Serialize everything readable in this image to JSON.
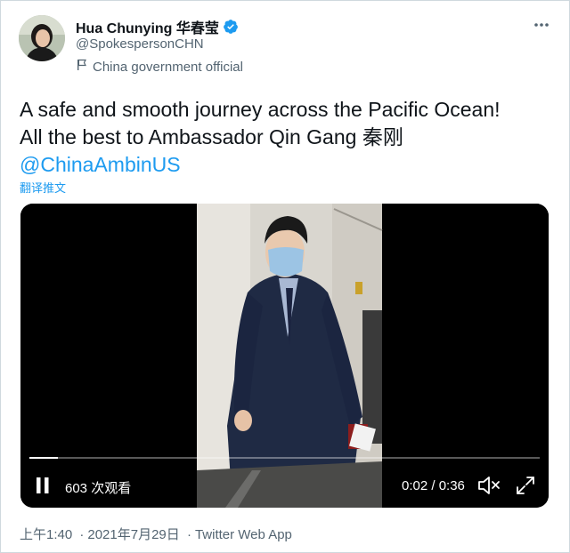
{
  "author": {
    "name": "Hua Chunying 华春莹",
    "handle": "@SpokespersonCHN",
    "label": "China government official"
  },
  "tweet": {
    "line1": "A safe and smooth journey across the Pacific Ocean!",
    "line2": "All the best to Ambassador Qin Gang 秦刚",
    "mention": "@ChinaAmbinUS",
    "translate": "翻译推文"
  },
  "video": {
    "views": "603 次观看",
    "time": "0:02 / 0:36",
    "progress": 0.055
  },
  "footer": {
    "time": "上午1:40",
    "date": "2021年7月29日",
    "source": "Twitter Web App",
    "separator": "·"
  },
  "icons": {
    "verified": "verified-badge-icon",
    "label": "flag-icon",
    "more": "more-icon",
    "pause": "pause-icon",
    "mute": "volume-muted-icon",
    "fullscreen": "fullscreen-icon"
  },
  "colors": {
    "accent": "#1d9bf0",
    "text": "#0f1419",
    "secondary": "#536471"
  }
}
